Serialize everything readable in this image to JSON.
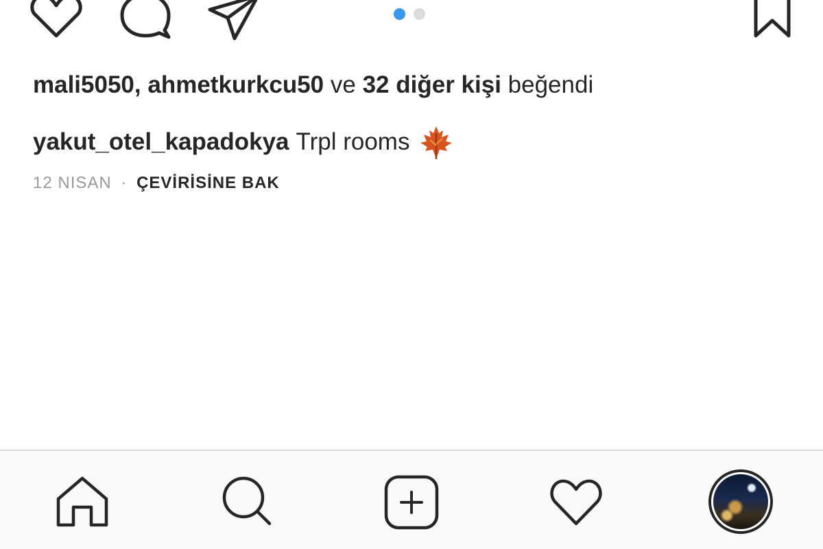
{
  "post": {
    "likes": {
      "user1": "mali5050,",
      "user2": "ahmetkurkcu50",
      "connector": "ve",
      "others": "32 diğer kişi",
      "suffix": "beğendi"
    },
    "caption": {
      "username": "yakut_otel_kapadokya",
      "text": "Trpl rooms",
      "emoji": "maple-leaf-icon"
    },
    "meta": {
      "date": "12 NISAN",
      "separator": "·",
      "translate": "ÇEVİRİSİNE BAK"
    },
    "carousel": {
      "count": 2,
      "active_index": 0,
      "active_color": "#3897f0",
      "inactive_color": "#dbdbdb"
    }
  },
  "actions": [
    "heart-icon",
    "comment-icon",
    "share-icon",
    "bookmark-icon"
  ],
  "tabbar": {
    "items": [
      "home-icon",
      "search-icon",
      "add-post-icon",
      "activity-heart-icon",
      "profile-avatar"
    ]
  }
}
